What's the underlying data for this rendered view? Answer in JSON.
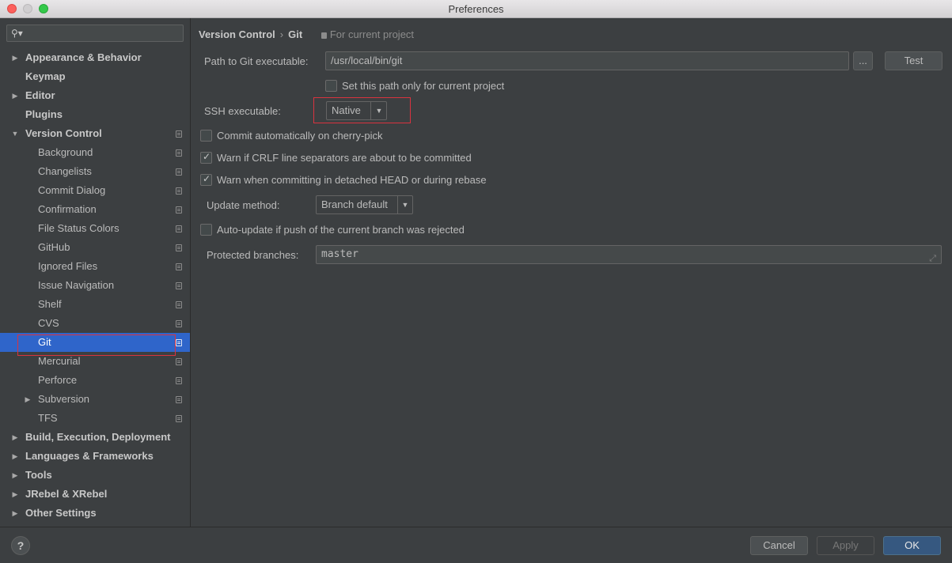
{
  "window": {
    "title": "Preferences"
  },
  "sidebar": {
    "search_placeholder": "",
    "items": [
      {
        "label": "Appearance & Behavior",
        "level": 0,
        "arrow": "▶",
        "icon": ""
      },
      {
        "label": "Keymap",
        "level": 0,
        "arrow": "",
        "icon": ""
      },
      {
        "label": "Editor",
        "level": 0,
        "arrow": "▶",
        "icon": ""
      },
      {
        "label": "Plugins",
        "level": 0,
        "arrow": "",
        "icon": ""
      },
      {
        "label": "Version Control",
        "level": 0,
        "arrow": "▼",
        "icon": "project-icon"
      },
      {
        "label": "Background",
        "level": 1,
        "arrow": "",
        "icon": "project-icon"
      },
      {
        "label": "Changelists",
        "level": 1,
        "arrow": "",
        "icon": "project-icon"
      },
      {
        "label": "Commit Dialog",
        "level": 1,
        "arrow": "",
        "icon": "project-icon"
      },
      {
        "label": "Confirmation",
        "level": 1,
        "arrow": "",
        "icon": "project-icon"
      },
      {
        "label": "File Status Colors",
        "level": 1,
        "arrow": "",
        "icon": "project-icon"
      },
      {
        "label": "GitHub",
        "level": 1,
        "arrow": "",
        "icon": "project-icon"
      },
      {
        "label": "Ignored Files",
        "level": 1,
        "arrow": "",
        "icon": "project-icon"
      },
      {
        "label": "Issue Navigation",
        "level": 1,
        "arrow": "",
        "icon": "project-icon"
      },
      {
        "label": "Shelf",
        "level": 1,
        "arrow": "",
        "icon": "project-icon"
      },
      {
        "label": "CVS",
        "level": 1,
        "arrow": "",
        "icon": "project-icon"
      },
      {
        "label": "Git",
        "level": 1,
        "arrow": "",
        "icon": "project-icon",
        "selected": true
      },
      {
        "label": "Mercurial",
        "level": 1,
        "arrow": "",
        "icon": "project-icon"
      },
      {
        "label": "Perforce",
        "level": 1,
        "arrow": "",
        "icon": "project-icon"
      },
      {
        "label": "Subversion",
        "level": 1,
        "arrow": "▶",
        "icon": "project-icon"
      },
      {
        "label": "TFS",
        "level": 1,
        "arrow": "",
        "icon": "project-icon"
      },
      {
        "label": "Build, Execution, Deployment",
        "level": 0,
        "arrow": "▶",
        "icon": ""
      },
      {
        "label": "Languages & Frameworks",
        "level": 0,
        "arrow": "▶",
        "icon": ""
      },
      {
        "label": "Tools",
        "level": 0,
        "arrow": "▶",
        "icon": ""
      },
      {
        "label": "JRebel & XRebel",
        "level": 0,
        "arrow": "▶",
        "icon": ""
      },
      {
        "label": "Other Settings",
        "level": 0,
        "arrow": "▶",
        "icon": ""
      }
    ]
  },
  "breadcrumb": {
    "parent": "Version Control",
    "separator": "›",
    "current": "Git",
    "scope": "For current project"
  },
  "git": {
    "path_label": "Path to Git executable:",
    "path_value": "/usr/local/bin/git",
    "browse_label": "...",
    "test_label": "Test",
    "path_only_project": {
      "label": "Set this path only for current project",
      "checked": false
    },
    "ssh_label": "SSH executable:",
    "ssh_value": "Native",
    "commit_cherry_pick": {
      "label": "Commit automatically on cherry-pick",
      "checked": false
    },
    "warn_crlf": {
      "label": "Warn if CRLF line separators are about to be committed",
      "checked": true
    },
    "warn_detached": {
      "label": "Warn when committing in detached HEAD or during rebase",
      "checked": true
    },
    "update_method_label": "Update method:",
    "update_method_value": "Branch default",
    "auto_update": {
      "label": "Auto-update if push of the current branch was rejected",
      "checked": false
    },
    "protected_label": "Protected branches:",
    "protected_value": "master"
  },
  "footer": {
    "help_label": "?",
    "cancel_label": "Cancel",
    "apply_label": "Apply",
    "ok_label": "OK"
  },
  "colors": {
    "selection": "#2f65ca",
    "highlight_box": "#d9333f",
    "ok_button": "#365880"
  }
}
